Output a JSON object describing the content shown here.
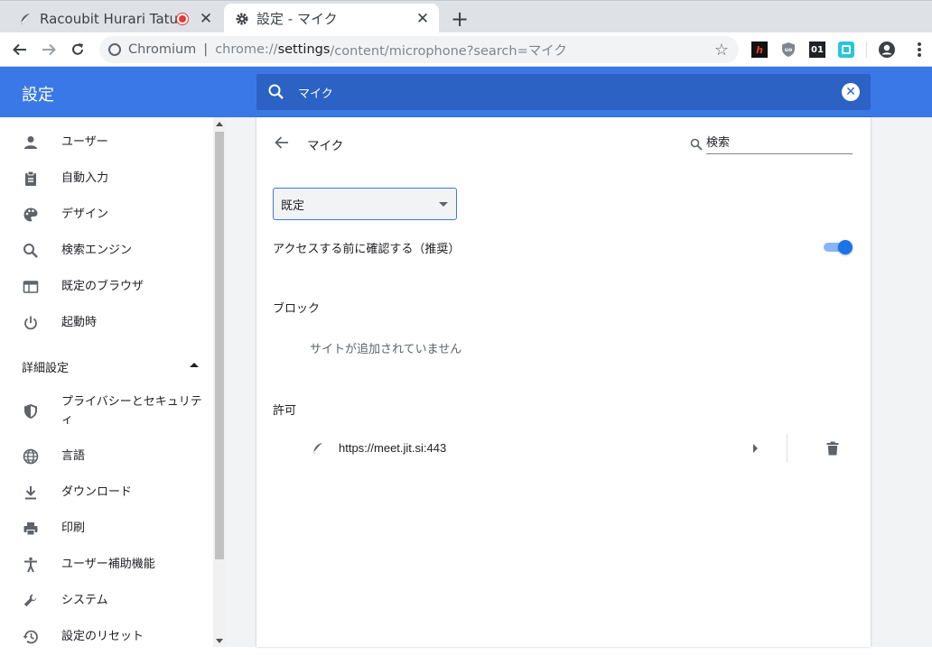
{
  "browser": {
    "tabs": [
      {
        "title": "Racoubit Hurari Tatuy",
        "active": false,
        "recording": true
      },
      {
        "title": "設定 - マイク",
        "active": true
      }
    ],
    "site_label": "Chromium",
    "url": {
      "scheme": "chrome://",
      "host": "settings",
      "rest": "/content/microphone?search=マイク"
    },
    "extensions": [
      "h",
      "shield",
      "01",
      "square"
    ]
  },
  "header": {
    "title": "設定",
    "search_value": "マイク"
  },
  "sidebar": {
    "items": [
      {
        "label": "ユーザー",
        "icon": "person-icon"
      },
      {
        "label": "自動入力",
        "icon": "clipboard-icon"
      },
      {
        "label": "デザイン",
        "icon": "palette-icon"
      },
      {
        "label": "検索エンジン",
        "icon": "search-icon"
      },
      {
        "label": "既定のブラウザ",
        "icon": "browser-icon"
      },
      {
        "label": "起動時",
        "icon": "power-icon"
      }
    ],
    "advanced_label": "詳細設定",
    "advanced_items": [
      {
        "label": "プライバシーとセキュリティ",
        "icon": "shield-icon"
      },
      {
        "label": "言語",
        "icon": "globe-icon"
      },
      {
        "label": "ダウンロード",
        "icon": "download-icon"
      },
      {
        "label": "印刷",
        "icon": "printer-icon"
      },
      {
        "label": "ユーザー補助機能",
        "icon": "accessibility-icon"
      },
      {
        "label": "システム",
        "icon": "wrench-icon"
      },
      {
        "label": "設定のリセット",
        "icon": "history-icon"
      }
    ]
  },
  "page": {
    "title": "マイク",
    "search_placeholder": "検索",
    "device_select": "既定",
    "ask_label": "アクセスする前に確認する（推奨）",
    "ask_enabled": true,
    "block_label": "ブロック",
    "block_empty": "サイトが追加されていません",
    "allow_label": "許可",
    "allowed_sites": [
      "https://meet.jit.si:443"
    ]
  },
  "colors": {
    "accent": "#3b78e7",
    "search_bg": "#2b62c4",
    "toggle": "#1a73e8"
  }
}
